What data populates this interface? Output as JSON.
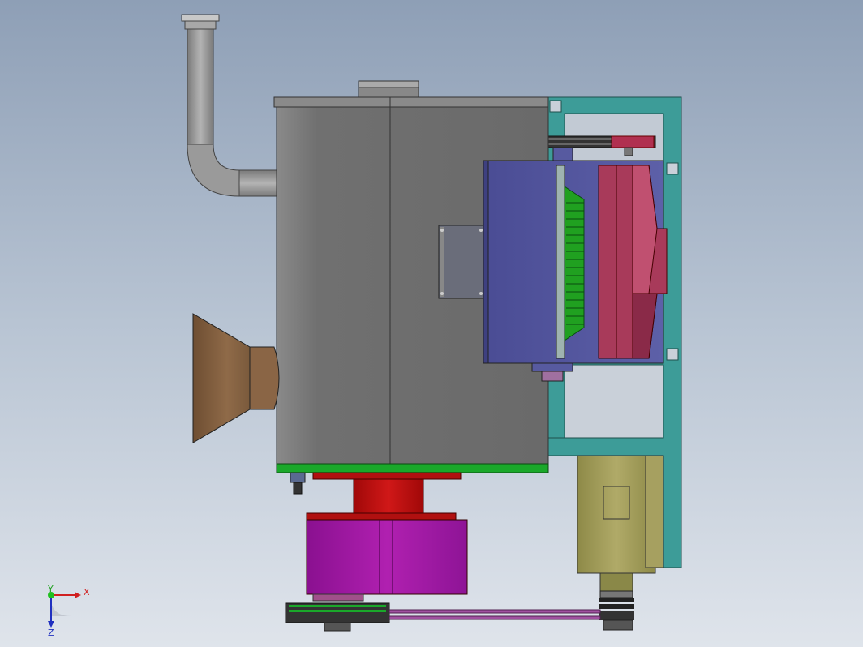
{
  "viewport": {
    "background_top": "#8e9fb6",
    "background_bottom": "#dfe4eb"
  },
  "model": {
    "parts": [
      {
        "name": "exhaust-pipe",
        "color": "#9a9a9a"
      },
      {
        "name": "main-housing",
        "color": "#6f6f6f"
      },
      {
        "name": "base-plate",
        "color": "#1aa82a"
      },
      {
        "name": "side-frame",
        "color": "#3d9c98"
      },
      {
        "name": "motor-cover",
        "color": "#575aa0"
      },
      {
        "name": "impeller-hub",
        "color": "#a83a5a"
      },
      {
        "name": "inlet-cone",
        "color": "#8a6545"
      },
      {
        "name": "flange-red",
        "color": "#c01010"
      },
      {
        "name": "drum-magenta",
        "color": "#a018a0"
      },
      {
        "name": "motor-body",
        "color": "#a6a060"
      },
      {
        "name": "belt",
        "color": "#a050a0"
      }
    ]
  },
  "triad": {
    "x_label": "X",
    "y_label": "Y",
    "z_label": "Z",
    "x_color": "#d02020",
    "y_color": "#20c020",
    "z_color": "#2030c0"
  }
}
